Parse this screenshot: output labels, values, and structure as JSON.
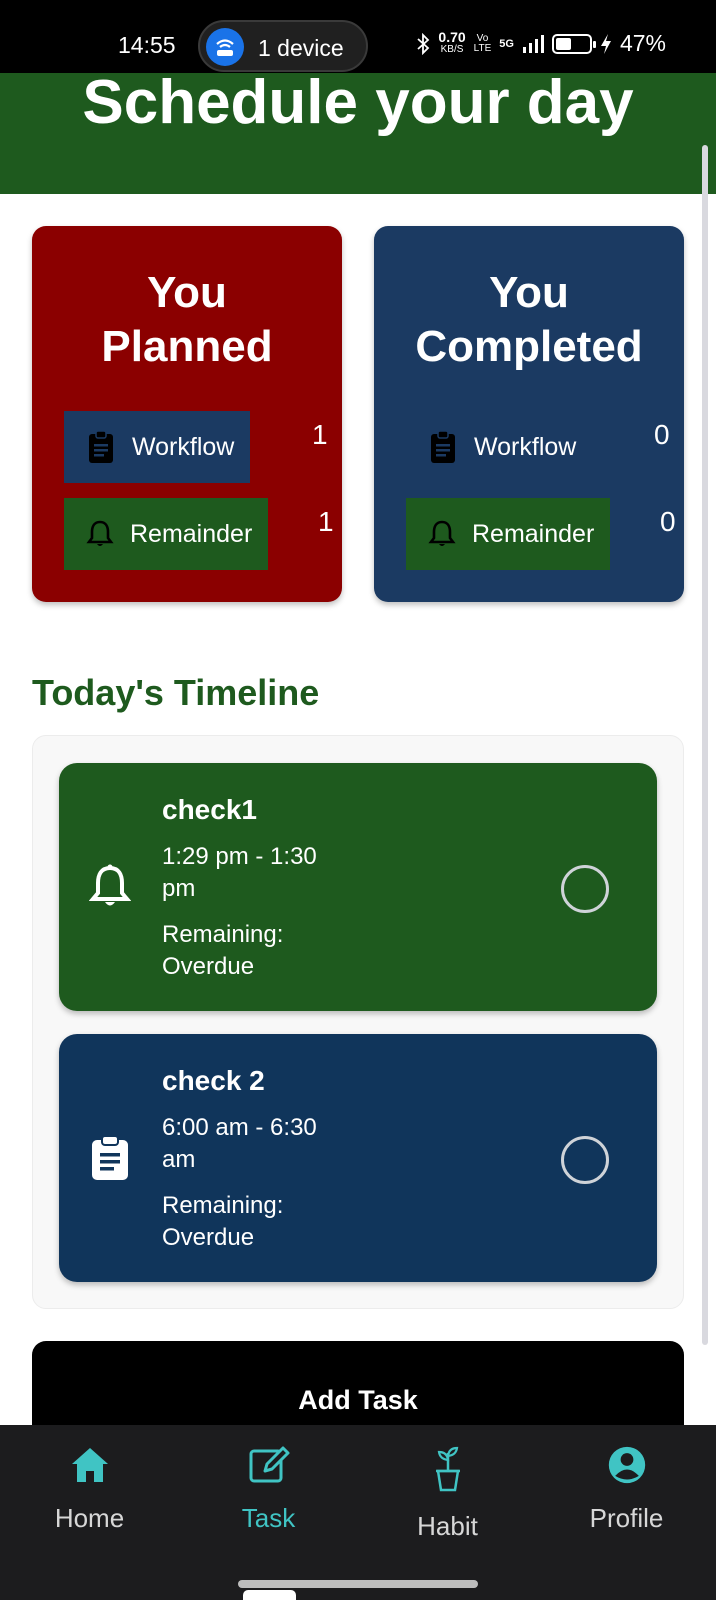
{
  "status_bar": {
    "time": "14:55",
    "hotspot_label": "1 device",
    "net_speed_value": "0.70",
    "net_speed_unit": "KB/S",
    "volte_top": "Vo",
    "volte_bottom": "LTE",
    "network_type": "5G",
    "battery_percent": "47%",
    "battery_level": 0.47
  },
  "header": {
    "title": "Schedule your day"
  },
  "planned": {
    "title_line1": "You",
    "title_line2": "Planned",
    "workflow_label": "Workflow",
    "workflow_count": "1",
    "reminder_label": "Remainder",
    "reminder_count": "1"
  },
  "completed": {
    "title_line1": "You",
    "title_line2": "Completed",
    "workflow_label": "Workflow",
    "workflow_count": "0",
    "reminder_label": "Remainder",
    "reminder_count": "0"
  },
  "timeline": {
    "title": "Today's Timeline",
    "tasks": [
      {
        "name": "check1",
        "time_line1": "1:29 pm - 1:30",
        "time_line2": "pm",
        "remain_line1": "Remaining:",
        "remain_line2": "Overdue",
        "icon": "bell-icon"
      },
      {
        "name": "check 2",
        "time_line1": "6:00 am - 6:30",
        "time_line2": "am",
        "remain_line1": "Remaining:",
        "remain_line2": "Overdue",
        "icon": "clipboard-icon"
      }
    ]
  },
  "add_task_label": "Add Task",
  "bottom_nav": {
    "items": [
      {
        "label": "Home",
        "icon": "home-icon"
      },
      {
        "label": "Task",
        "icon": "edit-icon",
        "active": true
      },
      {
        "label": "Habit",
        "icon": "plant-icon"
      },
      {
        "label": "Profile",
        "icon": "profile-icon"
      }
    ]
  },
  "colors": {
    "header_green": "#1e5a1e",
    "planned_red": "#8b0000",
    "completed_navy": "#1b3a62",
    "task_navy": "#10355b",
    "nav_active": "#40c4c4"
  }
}
